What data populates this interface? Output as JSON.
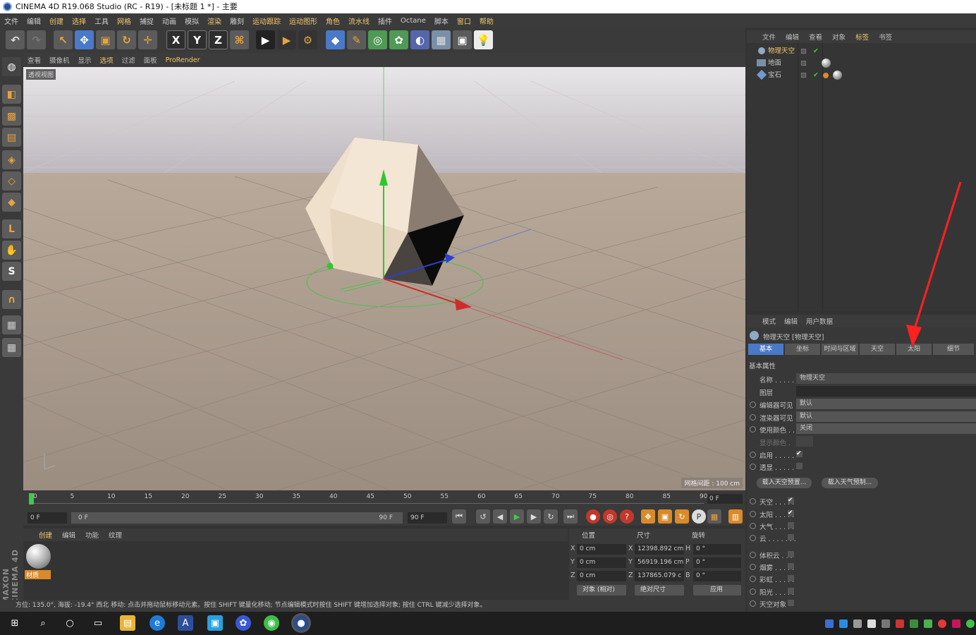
{
  "window": {
    "title": "CINEMA 4D R19.068 Studio (RC - R19) - [未标题 1 *] - 主要"
  },
  "menu": [
    "文件",
    "编辑",
    "创建",
    "选择",
    "工具",
    "网格",
    "捕捉",
    "动画",
    "模拟",
    "渲染",
    "雕刻",
    "运动跟踪",
    "运动图形",
    "角色",
    "流水线",
    "插件",
    "Octane",
    "脚本",
    "窗口",
    "帮助"
  ],
  "viewport": {
    "menu": [
      "查看",
      "摄像机",
      "显示",
      "选项",
      "过滤",
      "面板",
      "ProRender"
    ],
    "label": "透视视图",
    "grid_label": "网格间距 : 100 cm"
  },
  "timeline": {
    "ticks": [
      "0",
      "5",
      "10",
      "15",
      "20",
      "25",
      "30",
      "35",
      "40",
      "45",
      "50",
      "55",
      "60",
      "65",
      "70",
      "75",
      "80",
      "85",
      "90"
    ],
    "current_frame": "0 F",
    "start": "0 F",
    "slider_start": "0 F",
    "slider_end": "90 F",
    "end": "90 F"
  },
  "materials": {
    "menu": [
      "创建",
      "编辑",
      "功能",
      "纹理"
    ],
    "items": [
      {
        "name": "材质"
      }
    ]
  },
  "coordinates": {
    "headers": [
      "位置",
      "尺寸",
      "旋转"
    ],
    "rows": [
      {
        "axis": "X",
        "pos": "0 cm",
        "size_axis": "X",
        "size": "12398.892 cm",
        "rot_axis": "H",
        "rot": "0 °"
      },
      {
        "axis": "Y",
        "pos": "0 cm",
        "size_axis": "Y",
        "size": "56919.196 cm",
        "rot_axis": "P",
        "rot": "0 °"
      },
      {
        "axis": "Z",
        "pos": "0 cm",
        "size_axis": "Z",
        "size": "137865.079 c",
        "rot_axis": "B",
        "rot": "0 °"
      }
    ],
    "mode": "对象 (相对)",
    "size_mode": "绝对尺寸",
    "apply": "应用"
  },
  "status": "方位: 135.0°, 海拔: -19.4° 西北   移动: 点击并拖动鼠标移动元素。按住 SHIFT 键量化移动; 节点编辑模式时按住 SHIFT 键增加选择对象; 按住 CTRL 键减少选择对象。",
  "objects": {
    "menu": [
      "文件",
      "编辑",
      "查看",
      "对象",
      "标签",
      "书签"
    ],
    "items": [
      {
        "name": "物理天空",
        "selected": true
      },
      {
        "name": "地面",
        "selected": false
      },
      {
        "name": "宝石",
        "selected": false
      }
    ]
  },
  "attributes": {
    "menu": [
      "模式",
      "编辑",
      "用户数据"
    ],
    "object_title": "物理天空 [物理天空]",
    "tabs": [
      "基本",
      "坐标",
      "时间与区域",
      "天空",
      "太阳",
      "细节"
    ],
    "active_tab": "基本",
    "section": "基本属性",
    "fields": [
      {
        "label": "名称 . . . . .",
        "value": "物理天空"
      },
      {
        "label": "图层",
        "value": ""
      },
      {
        "label": "编辑器可见",
        "value": "默认"
      },
      {
        "label": "渲染器可见",
        "value": "默认"
      },
      {
        "label": "使用颜色 . .",
        "value": "关闭"
      },
      {
        "label": "显示颜色 .",
        "value": ""
      },
      {
        "label": "启用 . . . . .",
        "value": "✔"
      },
      {
        "label": "透显 . . . . .",
        "value": ""
      }
    ],
    "buttons": [
      "载入天空预置...",
      "载入天气预制..."
    ],
    "toggles": [
      {
        "label": "天空 . . . . .",
        "checked": true
      },
      {
        "label": "太阳 . . . . .",
        "checked": true
      },
      {
        "label": "大气 . . . . .",
        "checked": false
      },
      {
        "label": "云 . . . . . . .",
        "checked": false
      },
      {
        "label": "体积云 . . .",
        "checked": false
      },
      {
        "label": "烟雾 . . . . .",
        "checked": false
      },
      {
        "label": "彩虹 . . . . .",
        "checked": false
      },
      {
        "label": "阳光 . . . . .",
        "checked": false
      },
      {
        "label": "天空对象",
        "checked": false
      }
    ]
  },
  "brand": "MAXON CINEMA 4D"
}
